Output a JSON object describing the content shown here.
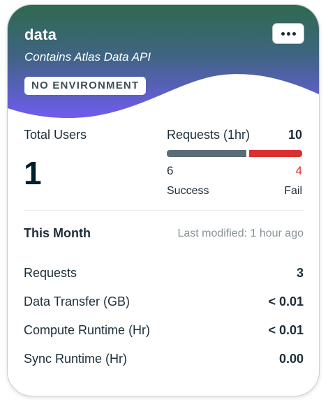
{
  "app": {
    "name": "data",
    "description": "Contains Atlas Data API",
    "environment_badge": "NO ENVIRONMENT",
    "menu_icon": "ellipsis-icon"
  },
  "users": {
    "label": "Total Users",
    "value": "1"
  },
  "requests_hour": {
    "label": "Requests (1hr)",
    "total": "10",
    "success_count": "6",
    "fail_count": "4",
    "success_label": "Success",
    "fail_label": "Fail",
    "success_fraction": 0.6,
    "colors": {
      "success": "#5c6c75",
      "fail": "#db3030"
    }
  },
  "this_month": {
    "title": "This Month",
    "last_modified": "Last modified: 1 hour ago",
    "rows": [
      {
        "label": "Requests",
        "value": "3"
      },
      {
        "label": "Data Transfer (GB)",
        "value": "< 0.01"
      },
      {
        "label": "Compute Runtime (Hr)",
        "value": "< 0.01"
      },
      {
        "label": "Sync Runtime (Hr)",
        "value": "0.00"
      }
    ]
  },
  "theme": {
    "header_gradient_start": "#2f6a4f",
    "header_gradient_end": "#6f5cf0"
  }
}
